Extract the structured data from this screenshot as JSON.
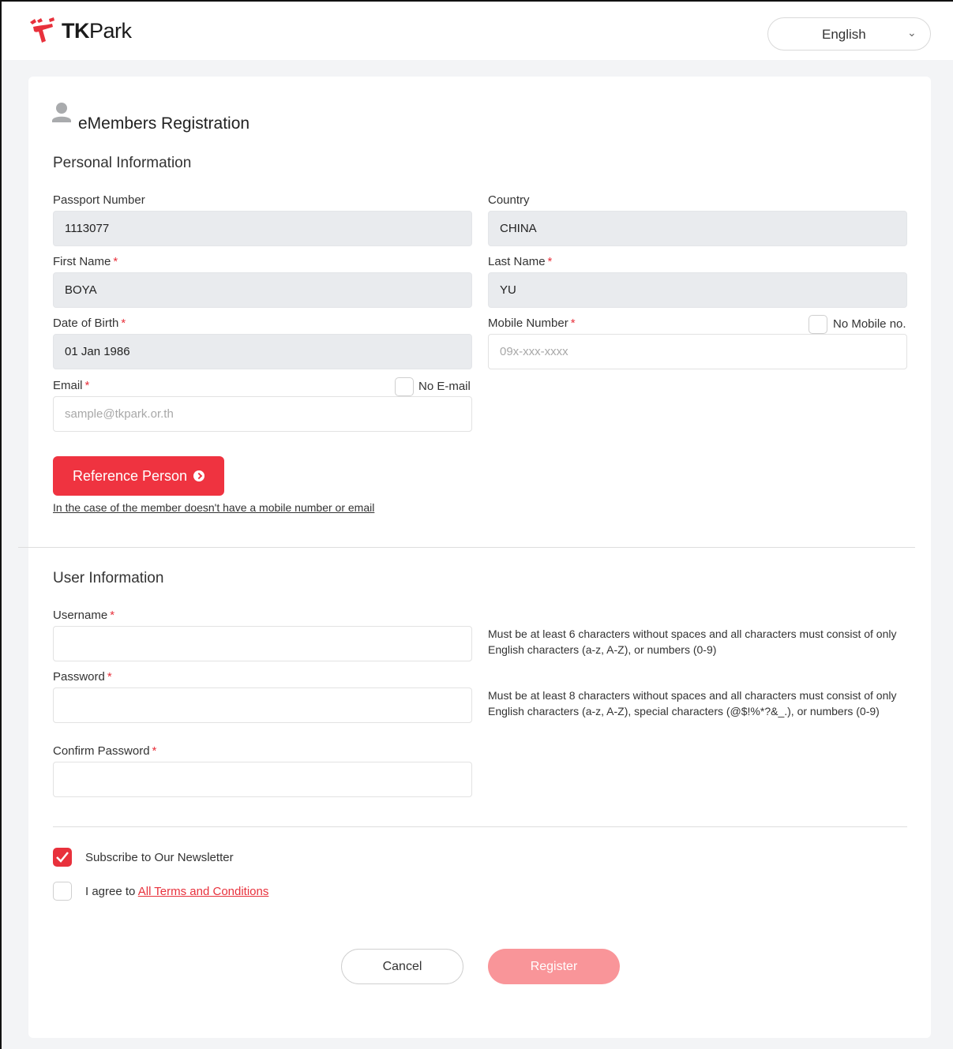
{
  "header": {
    "logo_text_bold": "TK",
    "logo_text_rest": "Park",
    "language": "English",
    "brand_color": "#e8313c"
  },
  "form": {
    "title": "eMembers Registration",
    "personal_section": "Personal Information",
    "passport_label": "Passport Number",
    "passport_value": "1113077",
    "country_label": "Country",
    "country_value": "CHINA",
    "first_name_label": "First Name",
    "first_name_value": "BOYA",
    "last_name_label": "Last Name",
    "last_name_value": "YU",
    "dob_label": "Date of Birth",
    "dob_value": "01 Jan 1986",
    "mobile_label": "Mobile Number",
    "no_mobile_label": "No Mobile no.",
    "mobile_placeholder": "09x-xxx-xxxx",
    "email_label": "Email",
    "no_email_label": "No E-mail",
    "email_placeholder": "sample@tkpark.or.th",
    "required_mark": "*",
    "reference_button": "Reference Person",
    "reference_note": "In the case of the member doesn't have a mobile number or email",
    "user_section": "User Information",
    "username_label": "Username",
    "username_hint": "Must be at least 6 characters without spaces and all characters must consist of only English characters (a-z, A-Z), or numbers (0-9)",
    "password_label": "Password",
    "password_hint": "Must be at least 8 characters without spaces and all characters must consist of only English characters (a-z, A-Z), special characters (@$!%*?&_.), or numbers (0-9)",
    "confirm_password_label": "Confirm Password",
    "newsletter_label": "Subscribe to Our Newsletter",
    "newsletter_checked": true,
    "agree_prefix": "I agree to",
    "terms_link": "All Terms and Conditions",
    "agree_checked": false,
    "cancel_button": "Cancel",
    "register_button": "Register"
  }
}
